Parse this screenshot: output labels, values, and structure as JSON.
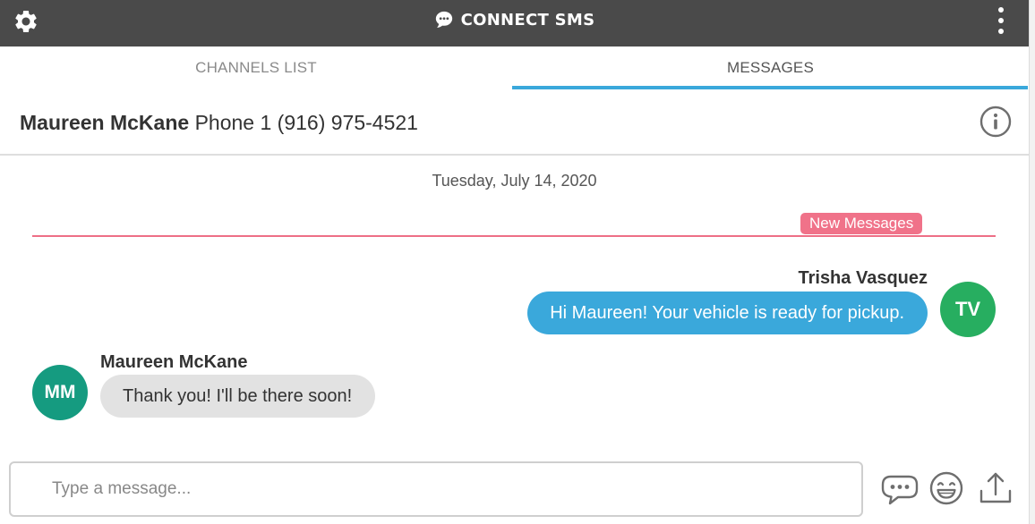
{
  "app": {
    "title": "CONNECT SMS",
    "icons": {
      "settings": "gear-icon",
      "logo": "chat-bubble-icon",
      "menu": "kebab-menu-icon"
    }
  },
  "tabs": [
    {
      "label": "CHANNELS LIST",
      "active": false
    },
    {
      "label": "MESSAGES",
      "active": true
    }
  ],
  "contact": {
    "name": "Maureen McKane",
    "phone_label": "Phone 1",
    "phone_number": "(916) 975-4521",
    "info_icon": "info-icon"
  },
  "conversation": {
    "date": "Tuesday, July 14, 2020",
    "new_messages_label": "New Messages",
    "messages": [
      {
        "direction": "outgoing",
        "sender": "Trisha Vasquez",
        "initials": "TV",
        "text": "Hi Maureen! Your vehicle is ready for pickup."
      },
      {
        "direction": "incoming",
        "sender": "Maureen McKane",
        "initials": "MM",
        "text": "Thank you! I'll be there soon!"
      }
    ]
  },
  "composer": {
    "placeholder": "Type a message...",
    "value": "",
    "tools": [
      "message-templates-icon",
      "emoji-icon",
      "upload-icon"
    ]
  },
  "colors": {
    "topbar": "#4a4a4a",
    "accent": "#3aa8db",
    "new_messages": "#f07289",
    "avatar_tv": "#27ae60",
    "avatar_mm": "#159b80",
    "incoming_bubble": "#e2e2e2"
  }
}
